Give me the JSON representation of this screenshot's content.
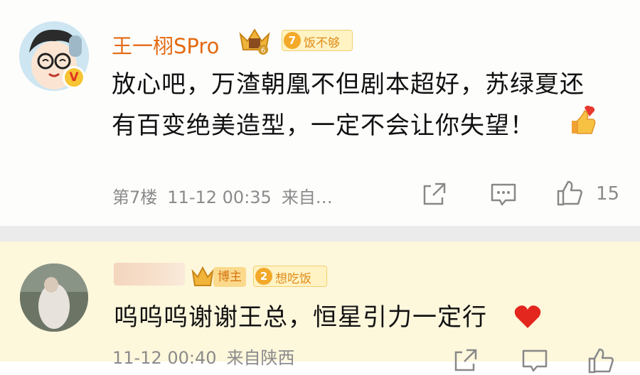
{
  "comments": [
    {
      "username": "王一栩SPro",
      "level_num": "7",
      "level_text": "饭不够",
      "text_line1": "放心吧，万渣朝凰不但剧本超好，苏绿夏还",
      "text_line2": "有百变绝美造型，一定不会让你失望！",
      "floor": "第7楼",
      "time": "11-12 00:35",
      "source": "来自…",
      "likes": "15",
      "icons": [
        "verified-v-icon",
        "crown-badge-icon",
        "thumbs-up-emoji",
        "share-icon",
        "comment-icon",
        "like-icon"
      ]
    },
    {
      "username": "",
      "bozhu": "博主",
      "level_num": "2",
      "level_text": "想吃饭",
      "text": "呜呜呜谢谢王总，恒星引力一定行",
      "time_partial": "11-12 00:40",
      "source_partial": "来自陕西",
      "icons": [
        "crown-badge-icon",
        "heart-emoji",
        "share-icon",
        "comment-icon",
        "like-icon"
      ]
    }
  ],
  "colors": {
    "username": "#e46a12",
    "meta": "#8b8b8b",
    "highlight_bg": "#fdf7dc",
    "divider": "#ebebeb"
  }
}
